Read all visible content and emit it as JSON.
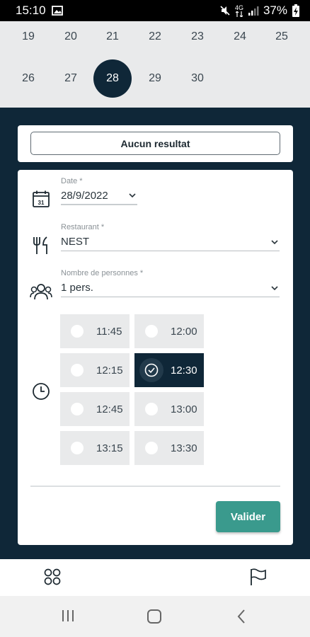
{
  "status_bar": {
    "time": "15:10",
    "battery": "37%",
    "net": "4G"
  },
  "calendar": {
    "row1": [
      "19",
      "20",
      "21",
      "22",
      "23",
      "24",
      "25"
    ],
    "row2": [
      "26",
      "27",
      "28",
      "29",
      "30"
    ],
    "selected_day": "28",
    "selected_color": "#0f2738"
  },
  "no_result_button": "Aucun resultat",
  "form": {
    "date": {
      "label": "Date *",
      "value": "28/9/2022"
    },
    "restaurant": {
      "label": "Restaurant *",
      "value": "NEST"
    },
    "persons": {
      "label": "Nombre de personnes *",
      "value": "1 pers."
    },
    "slots": [
      {
        "time": "11:45",
        "selected": false
      },
      {
        "time": "12:00",
        "selected": false
      },
      {
        "time": "12:15",
        "selected": false
      },
      {
        "time": "12:30",
        "selected": true
      },
      {
        "time": "12:45",
        "selected": false
      },
      {
        "time": "13:00",
        "selected": false
      },
      {
        "time": "13:15",
        "selected": false
      },
      {
        "time": "13:30",
        "selected": false
      }
    ],
    "submit_label": "Valider"
  },
  "icons": {
    "date": "calendar-icon",
    "restaurant": "fork-knife-icon",
    "persons": "people-icon",
    "time": "clock-icon",
    "tab_left": "grid-circles-icon",
    "tab_right": "flag-icon"
  },
  "colors": {
    "dark": "#0f2738",
    "accent": "#3a9a8d",
    "calendar_bg": "#e9eaeb"
  }
}
